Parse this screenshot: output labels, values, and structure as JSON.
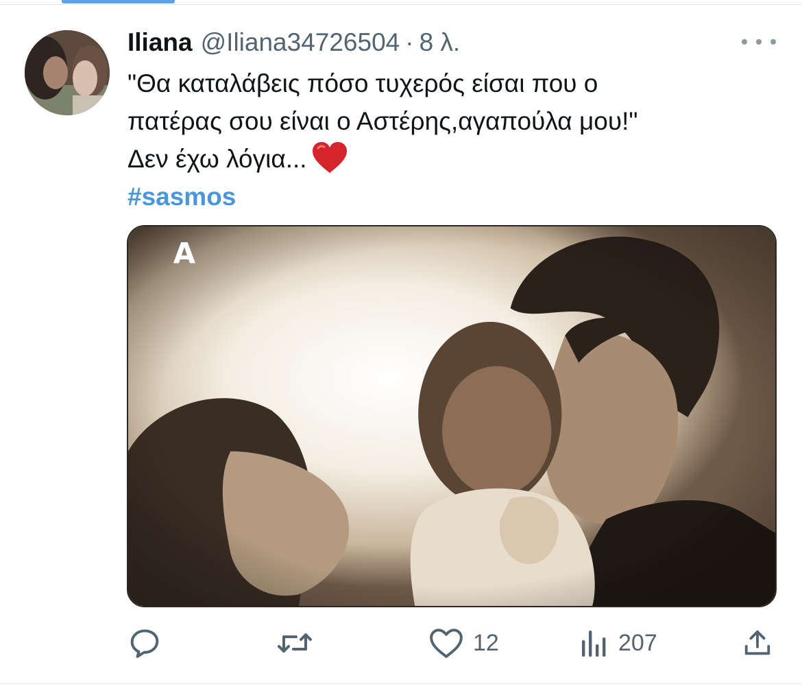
{
  "tweet": {
    "display_name": "Iliana",
    "handle": "@Iliana34726504",
    "separator": "·",
    "time": "8 λ.",
    "text_lines": [
      "\"Θα καταλάβεις πόσο τυχερός είσαι που ο",
      "πατέρας σου είναι ο Αστέρης,αγαπούλα μου!\"",
      "Δεν έχω λόγια..."
    ],
    "emoji": "heart-emoji",
    "hashtag": "#sasmos",
    "media_logo": "Α",
    "actions": {
      "reply_icon": "reply-icon",
      "retweet_icon": "retweet-icon",
      "like_icon": "like-icon",
      "like_count": "12",
      "views_icon": "views-icon",
      "views_count": "207",
      "share_icon": "share-icon"
    }
  },
  "colors": {
    "accent": "#5ba2e6",
    "hashtag": "#4a96d9",
    "secondary_text": "#536471",
    "primary_text": "#0f1419",
    "heart": "#d4252c"
  }
}
